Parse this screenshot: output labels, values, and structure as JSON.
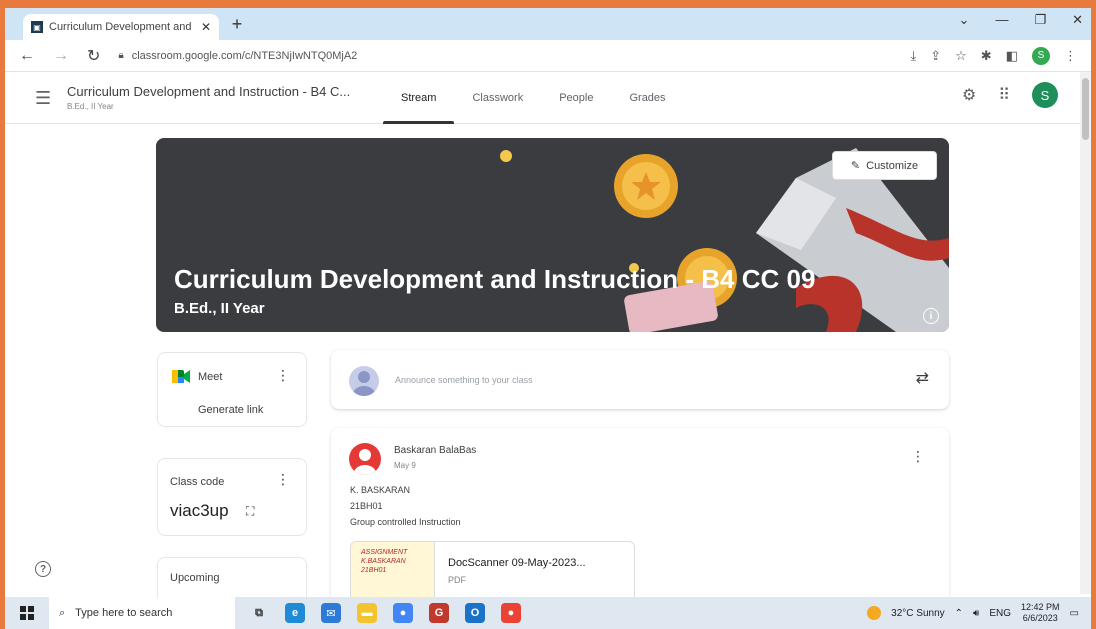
{
  "browser": {
    "tab_title": "Curriculum Development and In",
    "url": "classroom.google.com/c/NTE3NjIwNTQ0MjA2",
    "profile_initial": "S"
  },
  "header": {
    "course_title": "Curriculum Development and Instruction - B4 C...",
    "course_subtitle": "B.Ed., II Year",
    "tabs": [
      {
        "label": "Stream",
        "active": true
      },
      {
        "label": "Classwork",
        "active": false
      },
      {
        "label": "People",
        "active": false
      },
      {
        "label": "Grades",
        "active": false
      }
    ],
    "avatar_initial": "S"
  },
  "banner": {
    "title": "Curriculum Development and Instruction - B4 CC 09",
    "subtitle": "B.Ed., II Year",
    "customize_label": "Customize"
  },
  "meet": {
    "label": "Meet",
    "generate_link": "Generate link"
  },
  "class_code": {
    "label": "Class code",
    "code": "viac3up"
  },
  "upcoming": {
    "label": "Upcoming"
  },
  "announce": {
    "placeholder": "Announce something to your class"
  },
  "post": {
    "author": "Baskaran BalaBas",
    "date": "May 9",
    "lines": [
      "K. BASKARAN",
      "21BH01",
      "Group controlled Instruction"
    ],
    "attachment": {
      "name": "DocScanner 09-May-2023...",
      "type": "PDF",
      "thumb_text": "ASSIGNMENT K.BASKARAN 21BH01"
    }
  },
  "taskbar": {
    "search_placeholder": "Type here to search",
    "weather": "32°C Sunny",
    "language": "ENG",
    "time": "12:42 PM",
    "date": "6/6/2023"
  },
  "colors": {
    "accent_green": "#1e8e5a",
    "banner_bg": "#3a3c40",
    "post_avatar": "#e53935"
  }
}
